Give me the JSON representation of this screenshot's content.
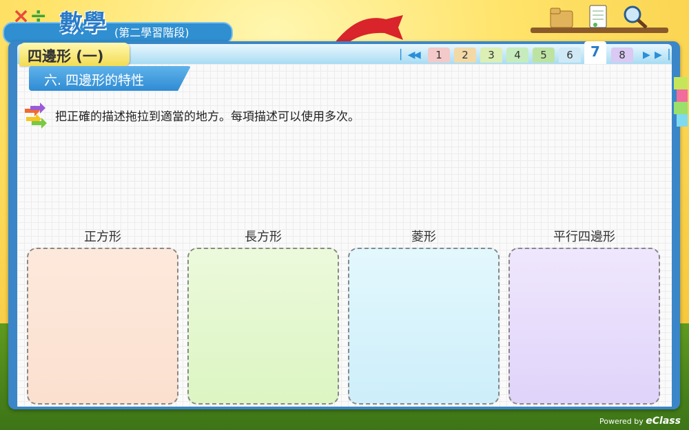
{
  "app": {
    "title": "數學",
    "subtitle": "(第二學習階段)"
  },
  "chapter": {
    "label": "四邊形 (一)"
  },
  "section": {
    "label": "六. 四邊形的特性"
  },
  "pager": {
    "pages": [
      "1",
      "2",
      "3",
      "4",
      "5",
      "6",
      "7",
      "8"
    ],
    "current": "7",
    "tab_colors": [
      "#f3c9c9",
      "#f2d9a6",
      "#dcefb4",
      "#c6ecbd",
      "#bde3a3",
      "#cfe9f6",
      "#ffffff",
      "#d9c9f3"
    ]
  },
  "instruction": "把正確的描述拖拉到適當的地方。每項描述可以使用多次。",
  "drop_zones": [
    {
      "label": "正方形",
      "color": "#fde6d8"
    },
    {
      "label": "長方形",
      "color": "#e4f8cd"
    },
    {
      "label": "菱形",
      "color": "#d7f3fb"
    },
    {
      "label": "平行四邊形",
      "color": "#e7dcfb"
    }
  ],
  "toolbar": {
    "icons": [
      "folder-icon",
      "notes-icon",
      "search-icon"
    ]
  },
  "footer": {
    "powered_by": "Powered by",
    "brand": "eClass"
  }
}
